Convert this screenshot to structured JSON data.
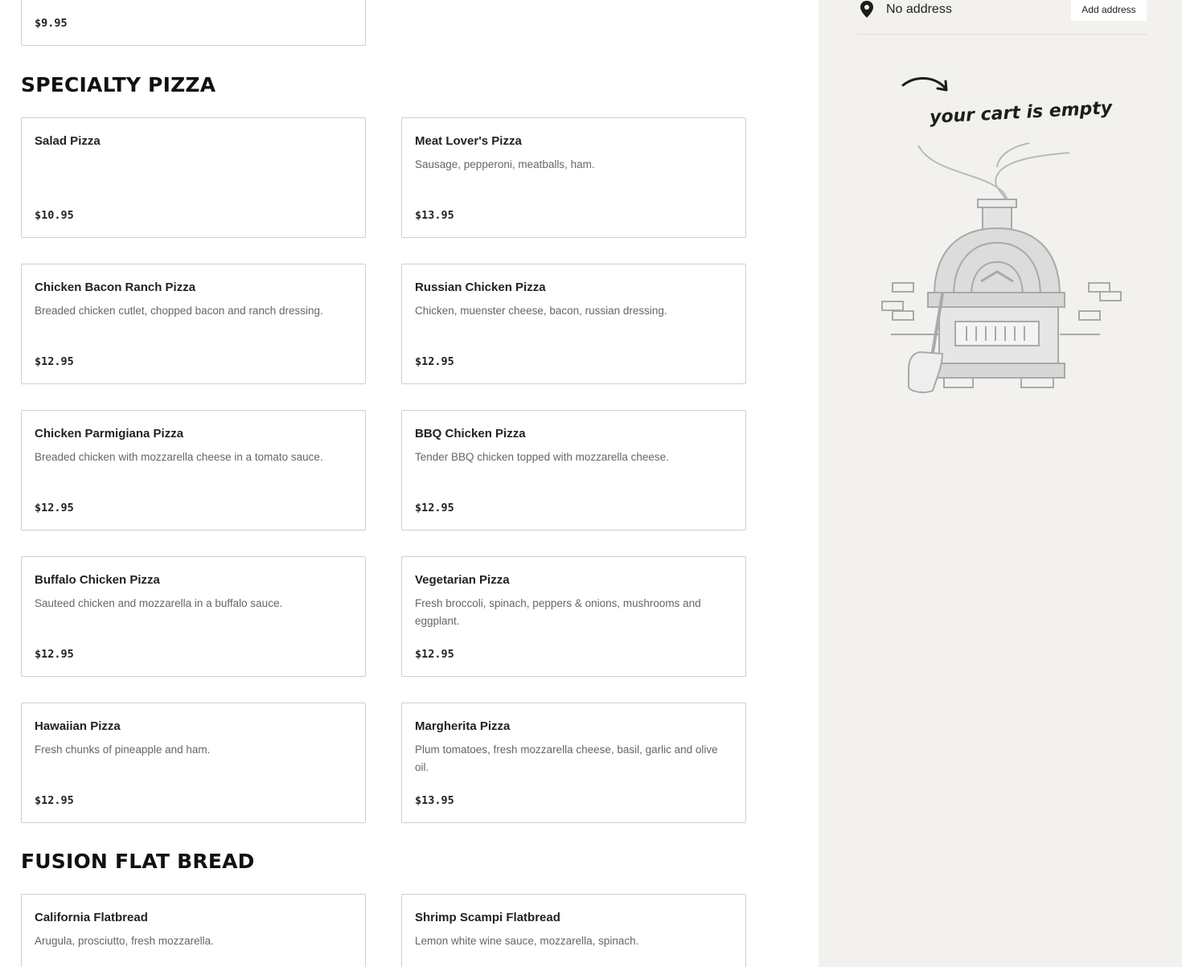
{
  "cards_top": {
    "partial_price": "$9.95"
  },
  "sections": [
    {
      "title": "SPECIALTY PIZZA",
      "items": [
        {
          "name": "Salad Pizza",
          "description": "",
          "price": "$10.95"
        },
        {
          "name": "Meat Lover's Pizza",
          "description": "Sausage, pepperoni, meatballs, ham.",
          "price": "$13.95"
        },
        {
          "name": "Chicken Bacon Ranch Pizza",
          "description": "Breaded chicken cutlet, chopped bacon and ranch dressing.",
          "price": "$12.95"
        },
        {
          "name": "Russian Chicken Pizza",
          "description": "Chicken, muenster cheese, bacon, russian dressing.",
          "price": "$12.95"
        },
        {
          "name": "Chicken Parmigiana Pizza",
          "description": "Breaded chicken with mozzarella cheese in a tomato sauce.",
          "price": "$12.95"
        },
        {
          "name": "BBQ Chicken Pizza",
          "description": "Tender BBQ chicken topped with mozzarella cheese.",
          "price": "$12.95"
        },
        {
          "name": "Buffalo Chicken Pizza",
          "description": "Sauteed chicken and mozzarella in a buffalo sauce.",
          "price": "$12.95"
        },
        {
          "name": "Vegetarian Pizza",
          "description": "Fresh broccoli, spinach, peppers & onions, mushrooms and eggplant.",
          "price": "$12.95"
        },
        {
          "name": "Hawaiian Pizza",
          "description": "Fresh chunks of pineapple and ham.",
          "price": "$12.95"
        },
        {
          "name": "Margherita Pizza",
          "description": "Plum tomatoes, fresh mozzarella cheese, basil, garlic and olive oil.",
          "price": "$13.95"
        }
      ]
    },
    {
      "title": "FUSION FLAT BREAD",
      "items": [
        {
          "name": "California Flatbread",
          "description": "Arugula, prosciutto, fresh mozzarella.",
          "price": ""
        },
        {
          "name": "Shrimp Scampi Flatbread",
          "description": "Lemon white wine sauce, mozzarella, spinach.",
          "price": ""
        }
      ]
    }
  ],
  "sidebar": {
    "address": "No address",
    "add_address_label": "Add address",
    "cart_empty_text": "your cart is empty",
    "icons": {
      "location": "map-pin-icon",
      "illustration": "pizza-oven-illustration"
    }
  }
}
